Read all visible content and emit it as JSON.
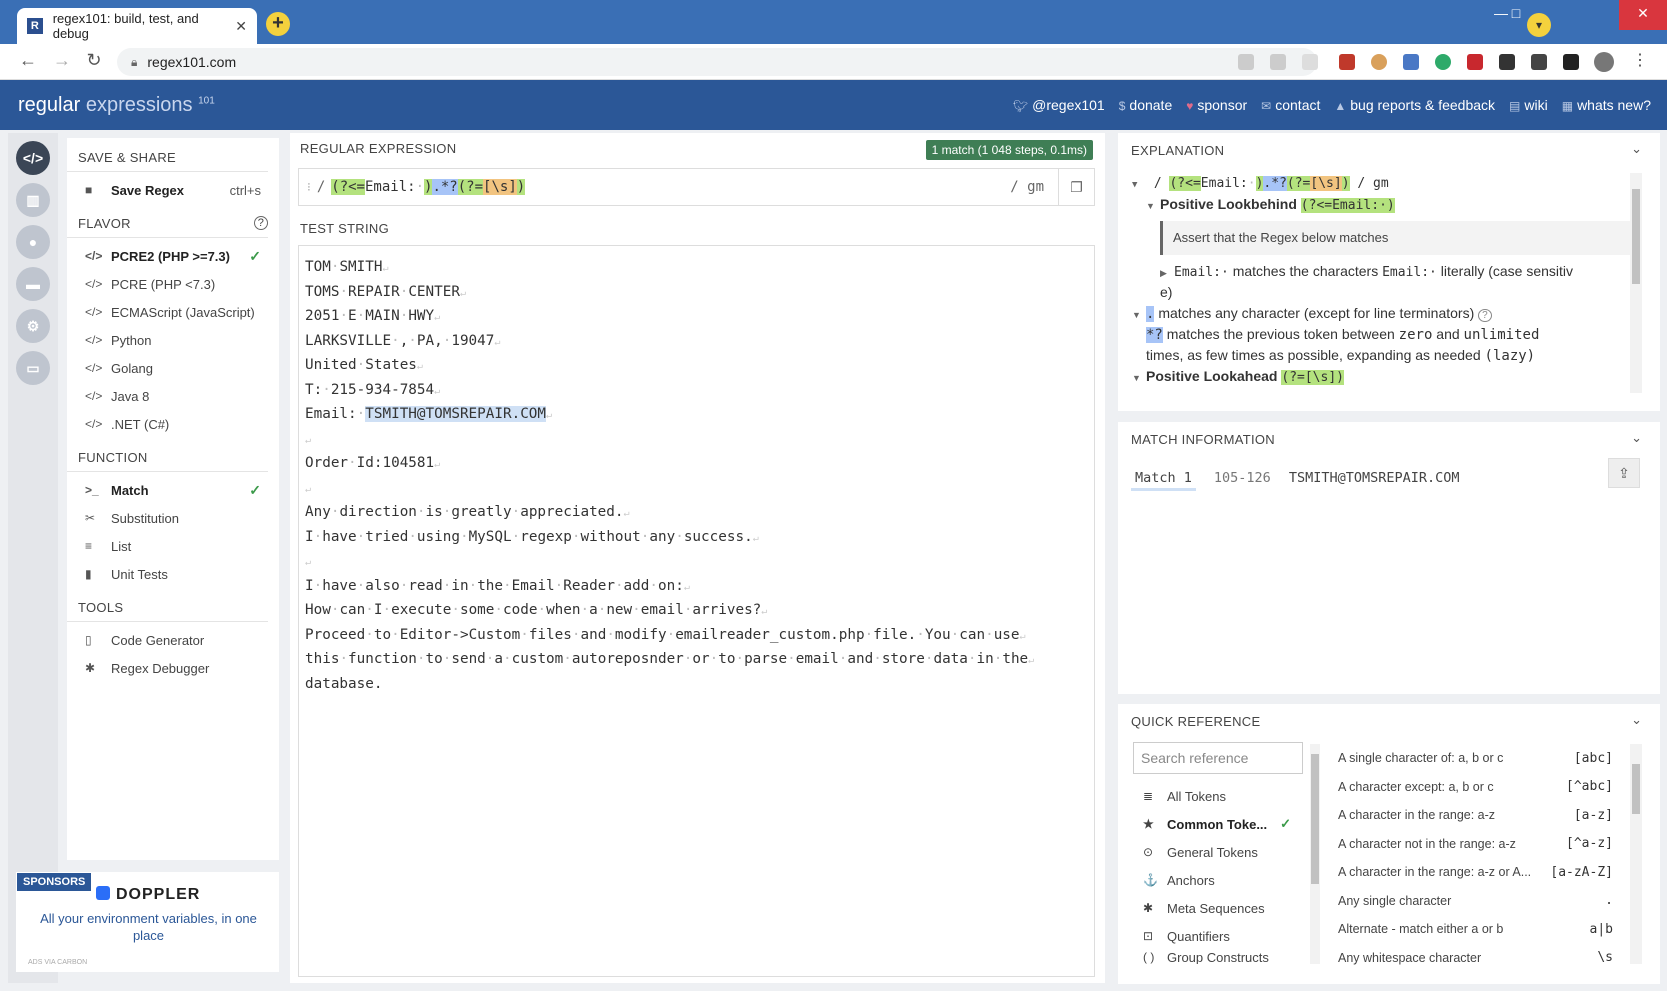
{
  "browser": {
    "tab_title": "regex101: build, test, and debug",
    "favicon": "R",
    "url": "regex101.com"
  },
  "header": {
    "logo_main": "regular",
    "logo_accent": "expressions",
    "logo_sup": "101",
    "links": [
      "@regex101",
      "donate",
      "sponsor",
      "contact",
      "bug reports & feedback",
      "wiki",
      "whats new?"
    ]
  },
  "sidebar": {
    "save_share": "SAVE & SHARE",
    "save_regex": "Save Regex",
    "save_shortcut": "ctrl+s",
    "flavor_heading": "FLAVOR",
    "flavors": [
      "PCRE2 (PHP >=7.3)",
      "PCRE (PHP <7.3)",
      "ECMAScript (JavaScript)",
      "Python",
      "Golang",
      "Java 8",
      ".NET (C#)"
    ],
    "function_heading": "FUNCTION",
    "functions": [
      "Match",
      "Substitution",
      "List",
      "Unit Tests"
    ],
    "tools_heading": "TOOLS",
    "tools": [
      "Code Generator",
      "Regex Debugger"
    ]
  },
  "sponsor": {
    "tag": "SPONSORS",
    "name": "DOPPLER",
    "text": "All your environment variables, in one place",
    "small": "ADS VIA CARBON"
  },
  "regex": {
    "label": "REGULAR EXPRESSION",
    "match_badge": "1 match (1 048 steps, 0.1ms)",
    "delimiter": "/",
    "part_lookbehind_open": "(?<=",
    "part_email": "Email:",
    "part_space": "·",
    "part_close": ")",
    "part_dot": ".",
    "part_lazy": "*?",
    "part_lookahead_open": "(?=",
    "part_class": "[\\s]",
    "part_close2": ")",
    "flags": "/ gm"
  },
  "test": {
    "label": "TEST STRING",
    "lines": [
      "TOM SMITH",
      "TOMS REPAIR CENTER",
      "2051 E MAIN HWY",
      "LARKSVILLE , PA, 19047",
      "United States",
      "T: 215-934-7854",
      "Email: ",
      "",
      "Order Id:104581",
      "",
      "Any direction is greatly appreciated.",
      "I have tried using MySQL regexp without any success.",
      "",
      "I have also read in the Email Reader add on:",
      "How can I execute some code when a new email arrives?",
      "Proceed to Editor->Custom files and modify emailreader_custom.php file. You can use",
      "this function to send a custom autoreposnder or to parse email and store data in the",
      "database."
    ],
    "match_text": "TSMITH@TOMSREPAIR.COM"
  },
  "explanation": {
    "heading": "EXPLANATION",
    "lookbehind_title": "Positive Lookbehind",
    "lookbehind_token": "(?<=Email:·)",
    "assert_text": "Assert that the Regex below matches",
    "email_token": "Email:·",
    "email_desc": "matches the characters",
    "email_code": "Email:·",
    "email_desc2": "literally (case sensitiv",
    "email_desc3": "e)",
    "dot_token": ".",
    "dot_desc": "matches any character (except for line terminators)",
    "lazy_token": "*?",
    "lazy_desc": "matches the previous token between",
    "lazy_zero": "zero",
    "lazy_and": "and",
    "lazy_unl": "unlimited",
    "lazy_desc2": "times, as few times as possible, expanding as needed",
    "lazy_code": "(lazy)",
    "lookahead_title": "Positive Lookahead",
    "lookahead_token": "(?=[\\s])"
  },
  "match_info": {
    "heading": "MATCH INFORMATION",
    "match_label": "Match 1",
    "range": "105-126",
    "value": "TSMITH@TOMSREPAIR.COM"
  },
  "quick_ref": {
    "heading": "QUICK REFERENCE",
    "search_placeholder": "Search reference",
    "categories": [
      "All Tokens",
      "Common Toke...",
      "General Tokens",
      "Anchors",
      "Meta Sequences",
      "Quantifiers",
      "Group Constructs"
    ],
    "items": [
      {
        "label": "A single character of: a, b or c",
        "value": "[abc]"
      },
      {
        "label": "A character except: a, b or c",
        "value": "[^abc]"
      },
      {
        "label": "A character in the range: a-z",
        "value": "[a-z]"
      },
      {
        "label": "A character not in the range: a-z",
        "value": "[^a-z]"
      },
      {
        "label": "A character in the range: a-z or A...",
        "value": "[a-zA-Z]"
      },
      {
        "label": "Any single character",
        "value": "."
      },
      {
        "label": "Alternate - match either a or b",
        "value": "a|b"
      },
      {
        "label": "Any whitespace character",
        "value": "\\s"
      }
    ]
  },
  "colors": {
    "header_bg": "#2b5797",
    "match_badge": "#3f7e55",
    "token_green": "#b4e27e",
    "token_blue": "#a7c4f7",
    "token_orange": "#f2c480"
  }
}
